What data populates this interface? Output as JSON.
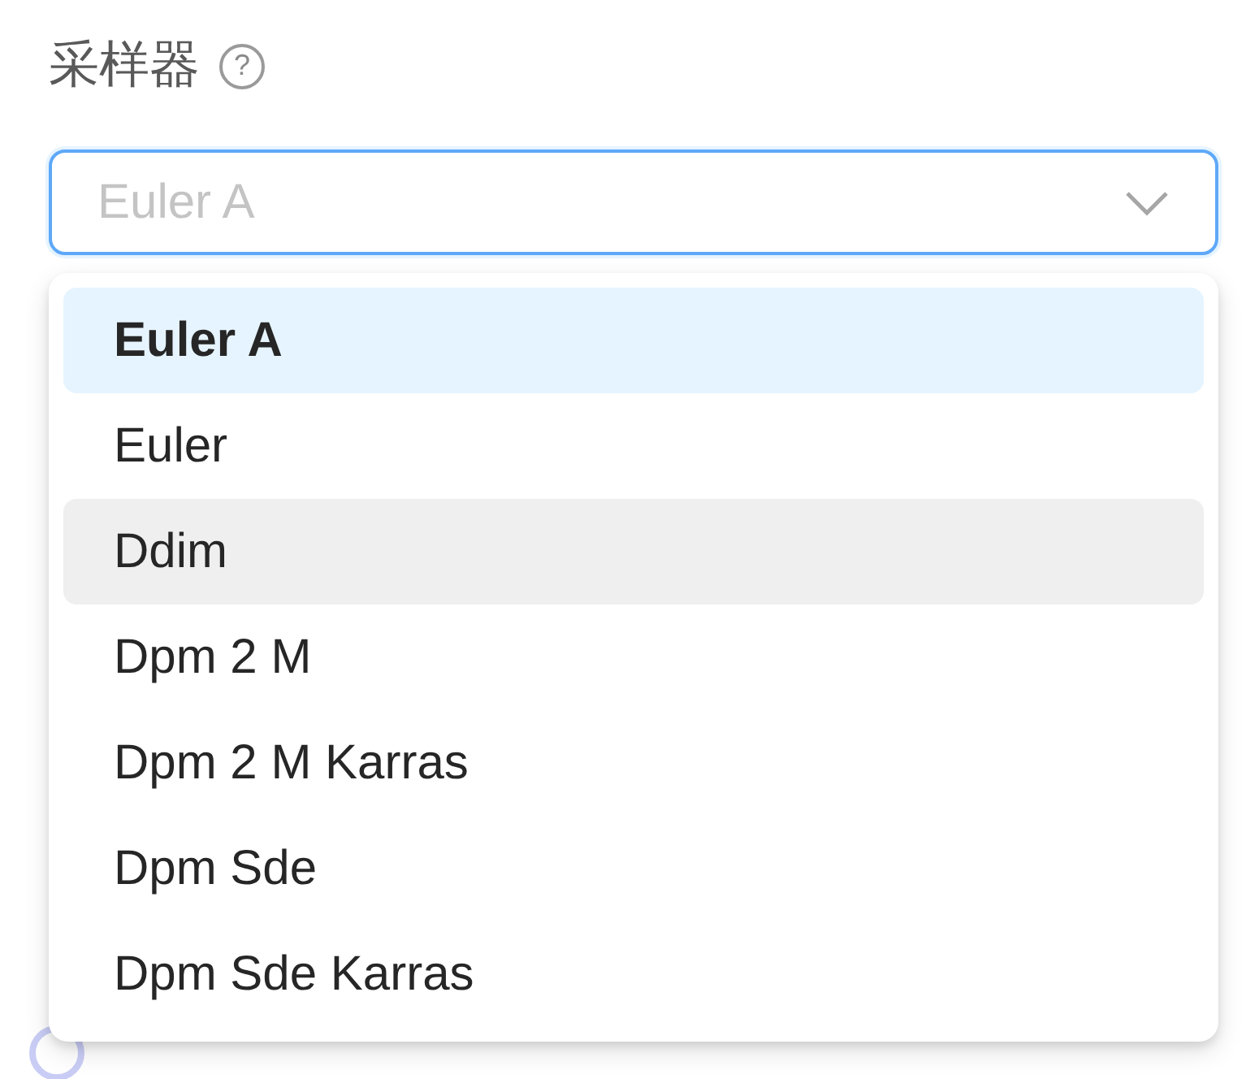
{
  "field": {
    "label": "采样器",
    "help": "?",
    "value": "Euler A",
    "open": true
  },
  "options": [
    {
      "label": "Euler A",
      "selected": true,
      "hovered": false
    },
    {
      "label": "Euler",
      "selected": false,
      "hovered": false
    },
    {
      "label": "Ddim",
      "selected": false,
      "hovered": true
    },
    {
      "label": "Dpm 2 M",
      "selected": false,
      "hovered": false
    },
    {
      "label": "Dpm 2 M Karras",
      "selected": false,
      "hovered": false
    },
    {
      "label": "Dpm Sde",
      "selected": false,
      "hovered": false
    },
    {
      "label": "Dpm Sde Karras",
      "selected": false,
      "hovered": false
    }
  ]
}
